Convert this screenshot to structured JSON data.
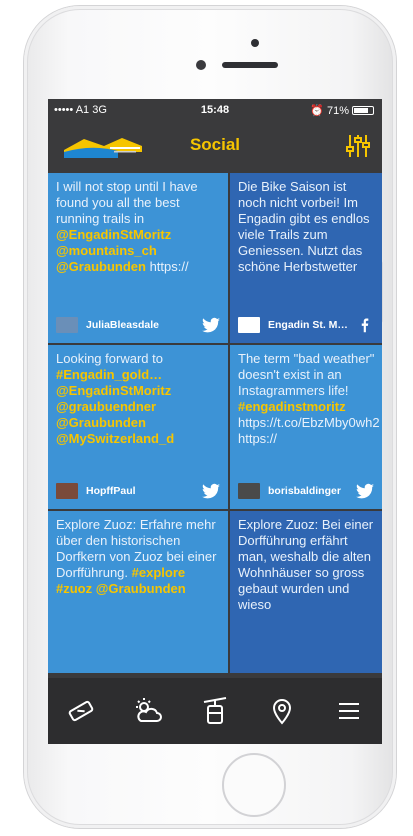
{
  "status": {
    "carrier": "••••• A1  3G",
    "time": "15:48",
    "battery": "71%"
  },
  "header": {
    "title": "Social",
    "logo_icon": "engadin-logo-icon",
    "filter_icon": "filter-sliders-icon"
  },
  "colors": {
    "accent": "#f6c500",
    "twitter_card": "#3d93d6",
    "facebook_card": "#2f66b2",
    "bar": "#3a3a3c"
  },
  "posts": [
    {
      "text": "I will not stop until I have found you all the best running trails in ",
      "tags": "@EngadinStMoritz @mountains_ch @Graubunden",
      "tail": " https://",
      "user": "JuliaBleasdale",
      "network": "twitter-icon"
    },
    {
      "text": "Die Bike Saison ist noch nicht vorbei! Im Engadin gibt es endlos viele Trails zum Geniessen. Nutzt das schöne Herbstwetter",
      "tags": "",
      "tail": "",
      "user": "Engadin St. M…",
      "network": "facebook-icon"
    },
    {
      "text": "Looking forward to ",
      "tags": "#Engadin_gold… @EngadinStMoritz @graubuendner @Graubunden @MySwitzerland_d",
      "tail": "",
      "user": "HopffPaul",
      "network": "twitter-icon"
    },
    {
      "text": "The term \"bad weather\" doesn't exist in an Instagrammers life! ",
      "tags": "#engadinstmoritz",
      "tail": " https://t.co/EbzMby0wh2 https://",
      "user": "borisbaldinger",
      "network": "twitter-icon"
    },
    {
      "text": "Explore Zuoz: Erfahre mehr über den historischen Dorfkern von Zuoz bei einer Dorfführung. ",
      "tags": "#explore #zuoz @Graubunden",
      "tail": "",
      "user": "",
      "network": ""
    },
    {
      "text": "Explore Zuoz: Bei einer Dorfführung erfährt man, weshalb die alten Wohnhäuser so gross gebaut wurden und wieso",
      "tags": "",
      "tail": "",
      "user": "",
      "network": ""
    }
  ],
  "tabs": [
    {
      "icon": "ticket-icon"
    },
    {
      "icon": "weather-icon"
    },
    {
      "icon": "cable-car-icon"
    },
    {
      "icon": "location-pin-icon"
    },
    {
      "icon": "menu-icon"
    }
  ]
}
